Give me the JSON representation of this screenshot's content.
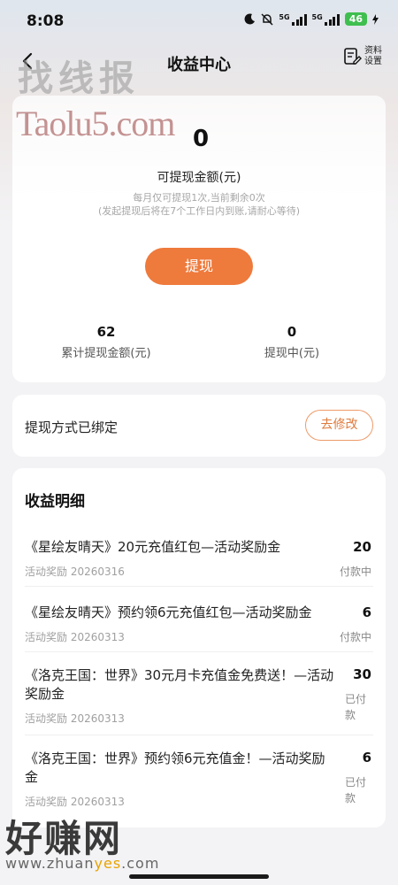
{
  "status_bar": {
    "time": "8:08",
    "signal1": "5G",
    "signal2": "5G",
    "battery": "46"
  },
  "header": {
    "title": "收益中心",
    "profile_label": "资料设置"
  },
  "watermark": {
    "top_text": "找线报",
    "site_text": "Taolu5.com",
    "bottom_text": "好赚网",
    "url_prefix": "www.zhuan",
    "url_highlight": "yes",
    "url_suffix": ".com"
  },
  "balance": {
    "amount": "0",
    "label": "可提现金额(元)",
    "note_1": "每月仅可提现1次,当前剩余0次",
    "note_2": "(发起提现后将在7个工作日内到账,请耐心等待)",
    "withdraw_button": "提现",
    "total_withdrawn_value": "62",
    "total_withdrawn_label": "累计提现金额(元)",
    "pending_value": "0",
    "pending_label": "提现中(元)"
  },
  "method": {
    "text": "提现方式已绑定",
    "modify_button": "去修改"
  },
  "earnings": {
    "title": "收益明细",
    "items": [
      {
        "title": "《星绘友晴天》20元充值红包—活动奖励金",
        "sub": "活动奖励 20260316",
        "amount": "20",
        "status": "付款中"
      },
      {
        "title": "《星绘友晴天》预约领6元充值红包—活动奖励金",
        "sub": "活动奖励 20260313",
        "amount": "6",
        "status": "付款中"
      },
      {
        "title": "《洛克王国：世界》30元月卡充值金免费送！—活动奖励金",
        "sub": "活动奖励 20260313",
        "amount": "30",
        "status": "已付款"
      },
      {
        "title": "《洛克王国：世界》预约领6元充值金！—活动奖励金",
        "sub": "活动奖励 20260313",
        "amount": "6",
        "status": "已付款"
      }
    ]
  },
  "colors": {
    "accent": "#ee7a3c",
    "accent_border": "#ee9a6a",
    "background": "#f3f3f5",
    "battery": "#3fbf4f"
  }
}
